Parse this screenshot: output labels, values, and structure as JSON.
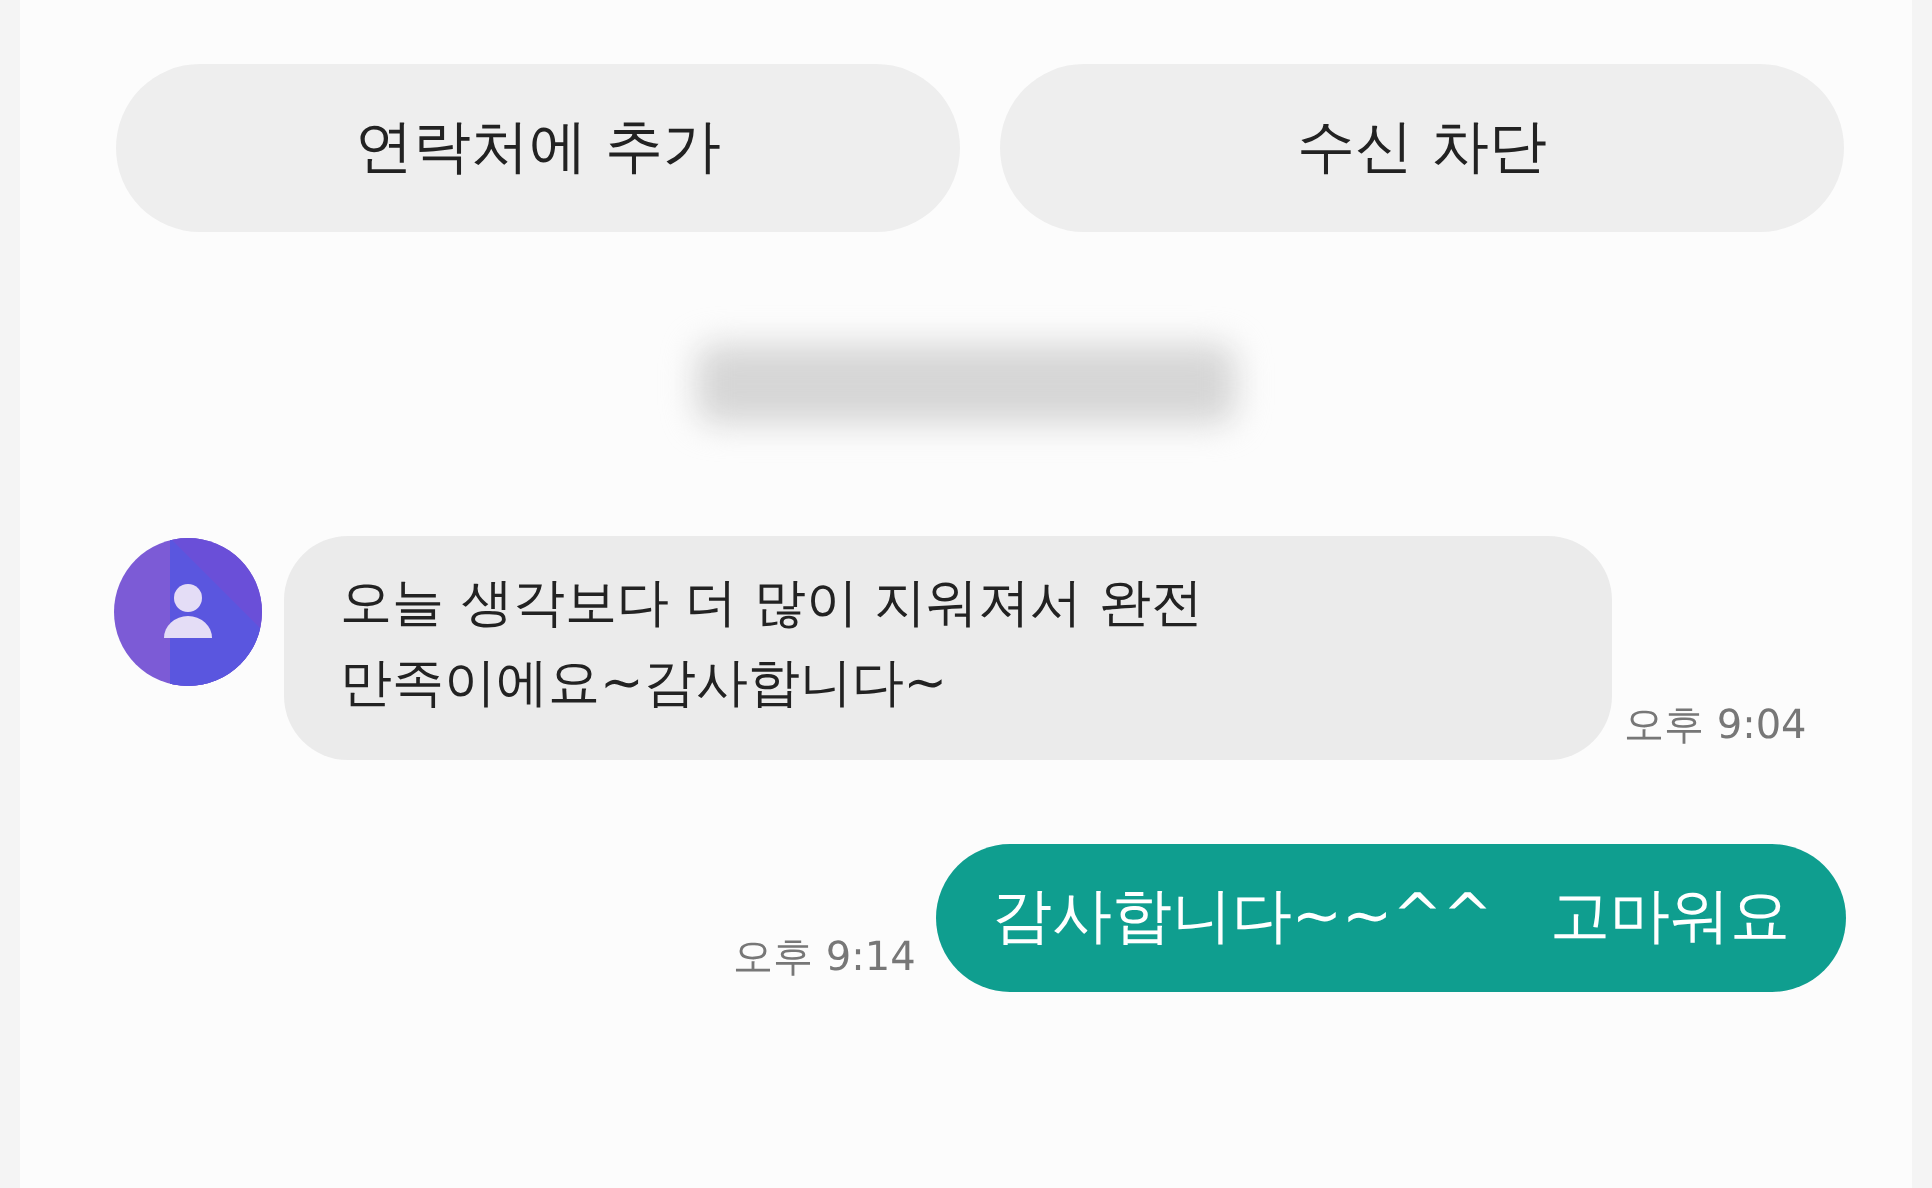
{
  "actions": [
    {
      "label": "연락처에 추가"
    },
    {
      "label": "수신 차단"
    }
  ],
  "messages": [
    {
      "kind": "incoming",
      "text": "오늘 생각보다 더 많이 지워져서 완전\n만족이에요~감사합니다~",
      "time": "오후 9:04"
    },
    {
      "kind": "outgoing",
      "text": "감사합니다~~^^   고마워요",
      "time": "오후 9:14"
    }
  ]
}
